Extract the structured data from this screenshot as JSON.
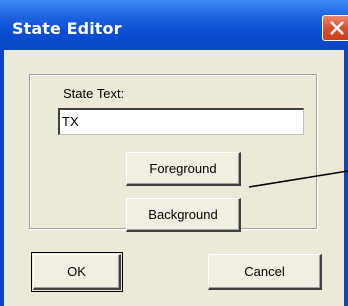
{
  "window": {
    "title": "State Editor",
    "close_icon": "close-x-icon"
  },
  "group": {
    "label": "State Text:",
    "text_value": "TX"
  },
  "color_buttons": {
    "foreground_label": "Foreground",
    "background_label": "Background"
  },
  "dialog_buttons": {
    "ok_label": "OK",
    "cancel_label": "Cancel"
  },
  "colors": {
    "titlebar": "#0a47c6",
    "client": "#ece9d8",
    "close_button": "#d8522f",
    "annotation_line": "#000000"
  }
}
